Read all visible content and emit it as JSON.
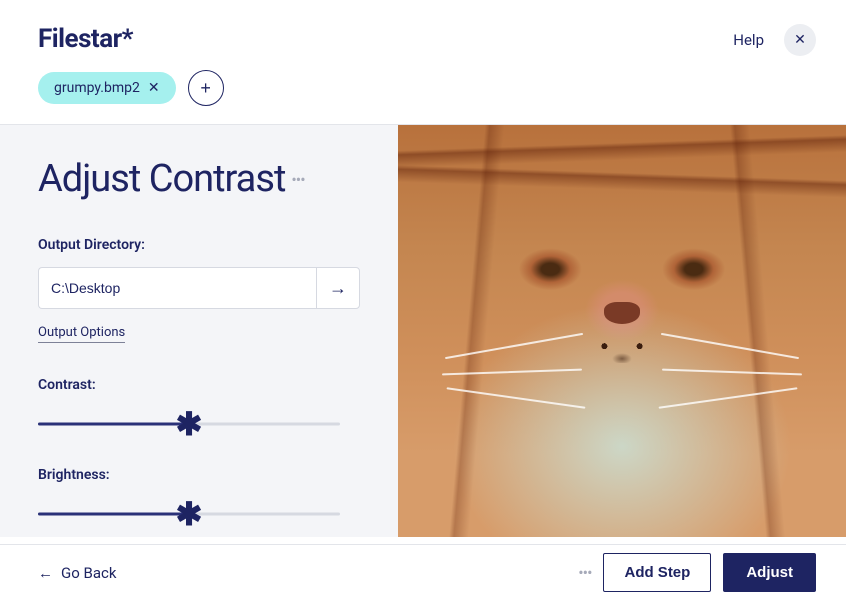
{
  "app": {
    "name": "Filestar*"
  },
  "header": {
    "help": "Help",
    "file_chip": {
      "label": "grumpy.bmp2"
    }
  },
  "page": {
    "title": "Adjust Contrast",
    "output_dir_label": "Output Directory:",
    "output_dir_value": "C:\\Desktop",
    "output_options_label": "Output Options",
    "contrast_label": "Contrast:",
    "brightness_label": "Brightness:",
    "sliders": {
      "contrast_pct": 50,
      "brightness_pct": 50
    }
  },
  "footer": {
    "go_back": "Go Back",
    "add_step": "Add Step",
    "adjust": "Adjust"
  }
}
